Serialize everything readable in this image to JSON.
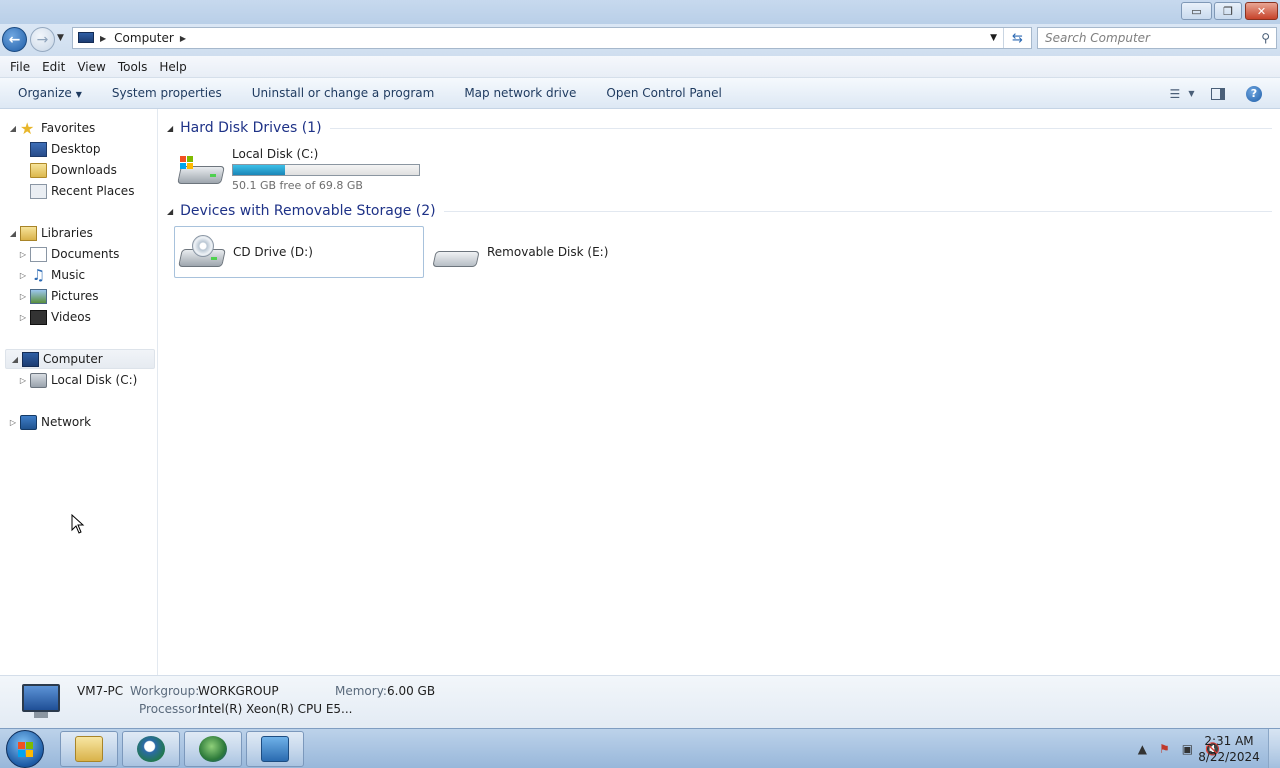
{
  "window": {
    "controls": {
      "minimize": "▭",
      "maximize": "❐",
      "close": "✕"
    }
  },
  "address_bar": {
    "breadcrumb": "Computer",
    "search_placeholder": "Search Computer"
  },
  "menu": [
    "File",
    "Edit",
    "View",
    "Tools",
    "Help"
  ],
  "command_bar": {
    "organize": "Organize",
    "items": [
      "System properties",
      "Uninstall or change a program",
      "Map network drive",
      "Open Control Panel"
    ]
  },
  "nav_pane": {
    "favorites": {
      "label": "Favorites",
      "items": [
        "Desktop",
        "Downloads",
        "Recent Places"
      ]
    },
    "libraries": {
      "label": "Libraries",
      "items": [
        "Documents",
        "Music",
        "Pictures",
        "Videos"
      ]
    },
    "computer": {
      "label": "Computer",
      "items": [
        "Local Disk (C:)"
      ]
    },
    "network": {
      "label": "Network"
    }
  },
  "content": {
    "hard_disks": {
      "heading": "Hard Disk Drives (1)",
      "drives": [
        {
          "name": "Local Disk (C:)",
          "free_text": "50.1 GB free of 69.8 GB",
          "used_fraction": 0.282
        }
      ]
    },
    "removable": {
      "heading": "Devices with Removable Storage (2)",
      "drives": [
        {
          "name": "CD Drive (D:)"
        },
        {
          "name": "Removable Disk (E:)"
        }
      ]
    }
  },
  "details": {
    "computer_name": "VM7-PC",
    "workgroup_label": "Workgroup:",
    "workgroup_value": "WORKGROUP",
    "memory_label": "Memory:",
    "memory_value": "6.00 GB",
    "processor_label": "Processor:",
    "processor_value": "Intel(R) Xeon(R) CPU E5..."
  },
  "taskbar": {
    "time": "2:31 AM",
    "date": "8/22/2024"
  },
  "colors": {
    "group_heading": "#1e3287",
    "usage_bar": "#1a86b8"
  }
}
